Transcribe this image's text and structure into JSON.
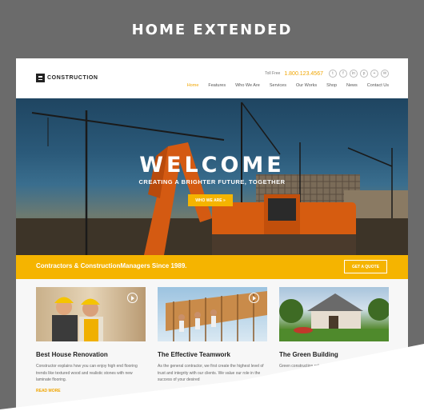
{
  "page_heading": "HOME EXTENDED",
  "header": {
    "logo_text": "CONSTRUCTION",
    "toll_free_label": "Toll Free",
    "phone": "1.800.123.4567",
    "social": [
      "twitter-icon",
      "facebook-icon",
      "linkedin-icon",
      "pinterest-icon",
      "plus-icon",
      "email-icon"
    ],
    "nav": [
      "Home",
      "Features",
      "Who We Are",
      "Services",
      "Our Works",
      "Shop",
      "News",
      "Contact Us"
    ]
  },
  "hero": {
    "title": "WELCOME",
    "subtitle": "CREATING A BRIGHTER FUTURE, TOGETHER",
    "button": "WHO WE ARE »"
  },
  "banner": {
    "text": "Contractors & ConstructionManagers Since 1989.",
    "button": "GET A QUOTE"
  },
  "cards": [
    {
      "title": "Best House Renovation",
      "text": "Constructor explains how you can enjoy high end flooring trends like textured wood and realistic stones with new laminate flooring.",
      "link": "READ MORE"
    },
    {
      "title": "The Effective Teamwork",
      "text": "As the general contractor, we first create the highest level of trust and integrity with our clients. We value our role in the success of your desired",
      "link": ""
    },
    {
      "title": "The Green Building",
      "text": "Green construction refers to a",
      "link": ""
    }
  ],
  "colors": {
    "accent": "#f5b400",
    "background": "#6b6b6b"
  }
}
